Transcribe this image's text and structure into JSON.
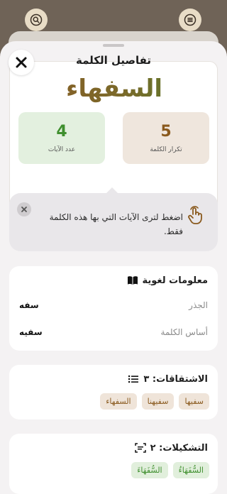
{
  "colors": {
    "accent_brown": "#8a5a1e",
    "accent_green": "#3f8f2e",
    "backdrop": "#6f6357"
  },
  "topbar": {
    "left_icon": "search-icon",
    "right_icon": "menu-icon"
  },
  "sheet": {
    "title": "تفاصيل الكلمة",
    "close_icon": "close-icon",
    "word": "السفهاء",
    "stats": {
      "repeat": {
        "value": "5",
        "label": "تكرار الكلمة"
      },
      "ayat": {
        "value": "4",
        "label": "عدد الآيات"
      }
    },
    "tip": {
      "text": "اضغط لترى الآيات التي بها هذه الكلمة فقط.",
      "icon": "tap-hand-icon"
    },
    "linguistic": {
      "title": "معلومات لغوية",
      "icon": "book-icon",
      "rows": [
        {
          "key": "الجذر",
          "value": "سفه"
        },
        {
          "key": "أساس الكلمة",
          "value": "سفيه"
        }
      ]
    },
    "derivatives": {
      "title": "الاشتقاقات: ٣",
      "icon": "list-icon",
      "chips": [
        "سفيها",
        "سفيهنا",
        "السفهاء"
      ]
    },
    "diacritics": {
      "title": "التشكيلات: ٢",
      "icon": "text-recognition-icon",
      "chips": [
        "السُّفَهَاءُ",
        "السُّفَهَاءَ"
      ]
    }
  }
}
